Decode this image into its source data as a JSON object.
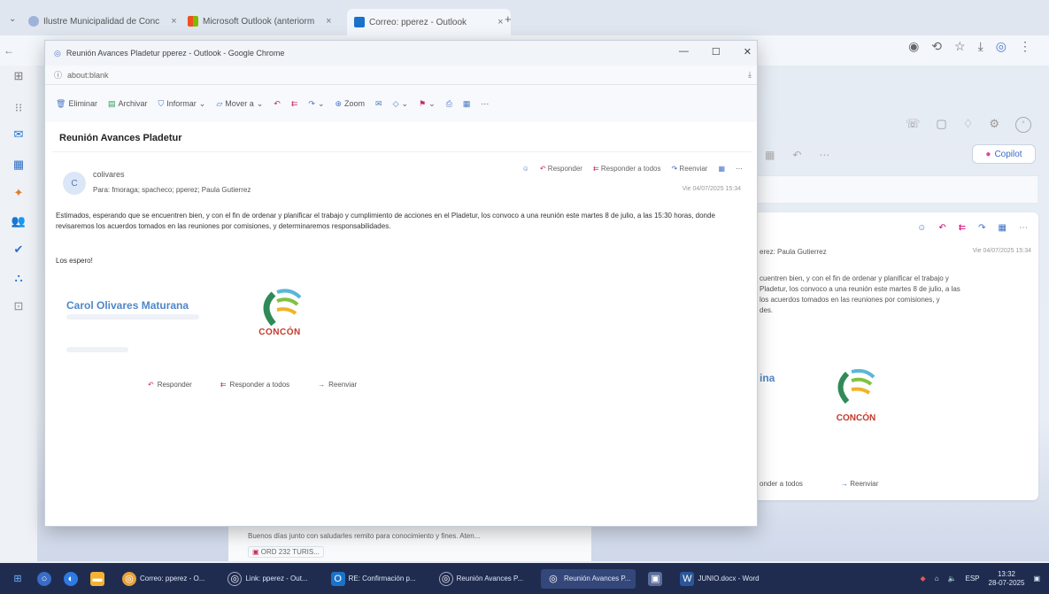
{
  "browser": {
    "tabs": [
      {
        "label": "Ilustre Municipalidad de Conc"
      },
      {
        "label": "Microsoft Outlook (anteriorm"
      },
      {
        "label": "Correo: pperez - Outlook"
      }
    ],
    "new_tab": "+"
  },
  "background_outlook": {
    "copilot_label": "Copilot",
    "recipients_fragment": "erez:  Paula Gutierrez",
    "date_fragment": "Vie 04/07/2025 15:34",
    "body_lines": [
      "cuentren bien, y con el fin de ordenar y planificar el trabajo y",
      "Pladetur, los convoco a una reunión este martes 8 de julio, a las",
      "los acuerdos tomados en las reuniones por comisiones, y",
      "des."
    ],
    "sig_fragment": "ina",
    "reply_fragment": "onder a todos",
    "forward_label": "Reenviar",
    "list_preview": "Buenos días junto con saludarles remito para conocimiento y fines. Aten...",
    "attachment": "ORD 232 TURIS..."
  },
  "popup": {
    "window_title": "Reunión Avances Pladetur pperez - Outlook - Google Chrome",
    "url": "about:blank",
    "toolbar": {
      "delete": "Eliminar",
      "archive": "Archivar",
      "report": "Informar",
      "move": "Mover a",
      "zoom": "Zoom"
    },
    "subject": "Reunión Avances Pladetur",
    "avatar_letter": "C",
    "sender": "colivares",
    "recipients": "Para: fmoraga;  spacheco;  pperez;  Paula Gutierrez",
    "actions": {
      "reply": "Responder",
      "reply_all": "Responder a todos",
      "forward": "Reenviar"
    },
    "date": "Vie 04/07/2025 15:34",
    "body": "Estimados, esperando que se encuentren bien, y con el fin de ordenar y planificar el trabajo y cumplimiento de acciones en el Pladetur, los convoco a una reunión este martes 8 de julio, a las 15:30 horas, donde revisaremos los acuerdos tomados en las reuniones por comisiones, y determinaremos responsabilidades.",
    "greeting": "Los espero!",
    "signature_name": "Carol Olivares Maturana",
    "logo_word": "CONCÓN",
    "bottom_actions": {
      "reply": "Responder",
      "reply_all": "Responder a todos",
      "forward": "Reenviar"
    }
  },
  "taskbar": {
    "apps": [
      {
        "label": "Correo: pperez - O..."
      },
      {
        "label": "Link: pperez - Out..."
      },
      {
        "label": "RE: Confirmación p..."
      },
      {
        "label": "Reunión Avances P..."
      },
      {
        "label": "Reunión Avances P..."
      },
      {
        "label": "JUNIO.docx - Word"
      }
    ],
    "lang": "ESP",
    "time": "13:32",
    "date": "28-07-2025"
  }
}
